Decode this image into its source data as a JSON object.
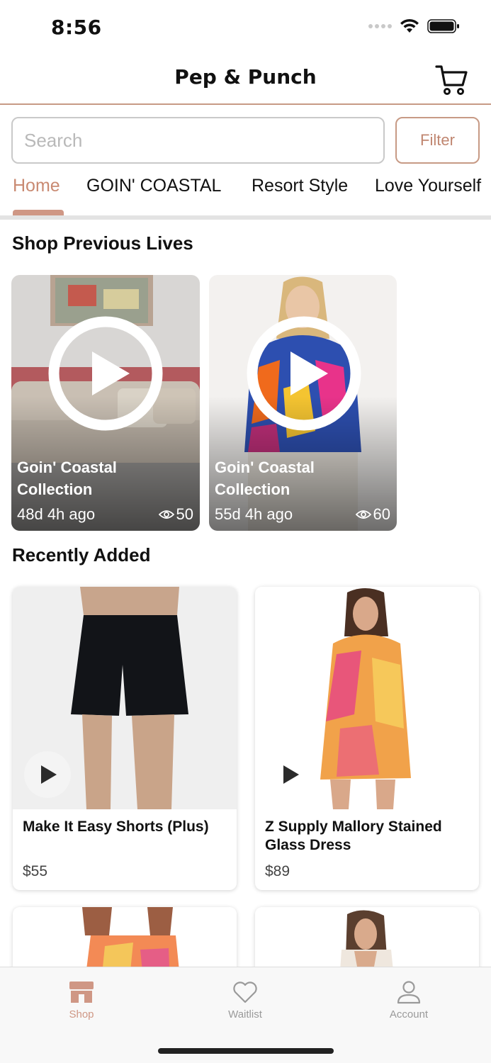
{
  "status_bar": {
    "time": "8:56"
  },
  "header": {
    "title": "Pep & Punch",
    "cart_icon": "cart-icon"
  },
  "search": {
    "placeholder": "Search",
    "value": "",
    "filter_label": "Filter"
  },
  "category_tabs": [
    {
      "label": "Home",
      "active": true
    },
    {
      "label": "GOIN' COASTAL",
      "active": false
    },
    {
      "label": "Resort Style",
      "active": false
    },
    {
      "label": "Love Yourself",
      "active": false
    }
  ],
  "previous_lives": {
    "title": "Shop Previous Lives",
    "items": [
      {
        "title": "Goin' Coastal Collection",
        "ago": "48d 4h ago",
        "views": "50"
      },
      {
        "title": "Goin' Coastal Collection",
        "ago": "55d 4h ago",
        "views": "60"
      }
    ]
  },
  "recently_added": {
    "title": "Recently Added",
    "items": [
      {
        "name": "Make It Easy Shorts (Plus)",
        "price": "$55"
      },
      {
        "name": "Z Supply Mallory Stained Glass Dress",
        "price": "$89"
      }
    ]
  },
  "tab_bar": [
    {
      "label": "Shop",
      "icon": "storefront-icon",
      "active": true
    },
    {
      "label": "Waitlist",
      "icon": "heart-icon",
      "active": false
    },
    {
      "label": "Account",
      "icon": "person-icon",
      "active": false
    }
  ],
  "colors": {
    "accent": "#cf9785",
    "accent_text": "#c98a72",
    "header_border": "#c79a85"
  }
}
